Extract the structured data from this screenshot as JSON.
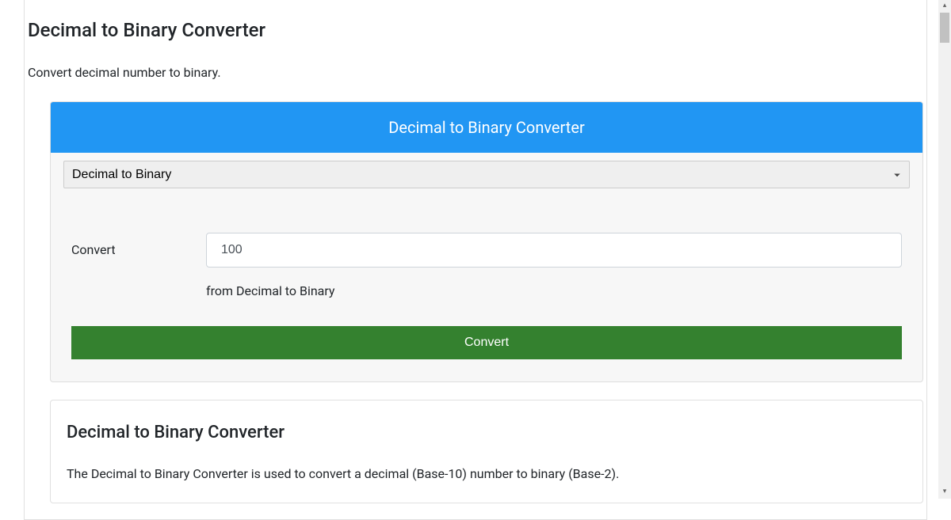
{
  "page": {
    "title": "Decimal to Binary Converter",
    "subtitle": "Convert decimal number to binary."
  },
  "converter": {
    "header": "Decimal to Binary Converter",
    "selected_option": "Decimal to Binary",
    "form_label": "Convert",
    "input_value": "100",
    "helper_text": "from Decimal to Binary",
    "button_label": "Convert"
  },
  "info": {
    "title": "Decimal to Binary Converter",
    "text": "The Decimal to Binary Converter is used to convert a decimal (Base-10) number to binary (Base-2)."
  }
}
